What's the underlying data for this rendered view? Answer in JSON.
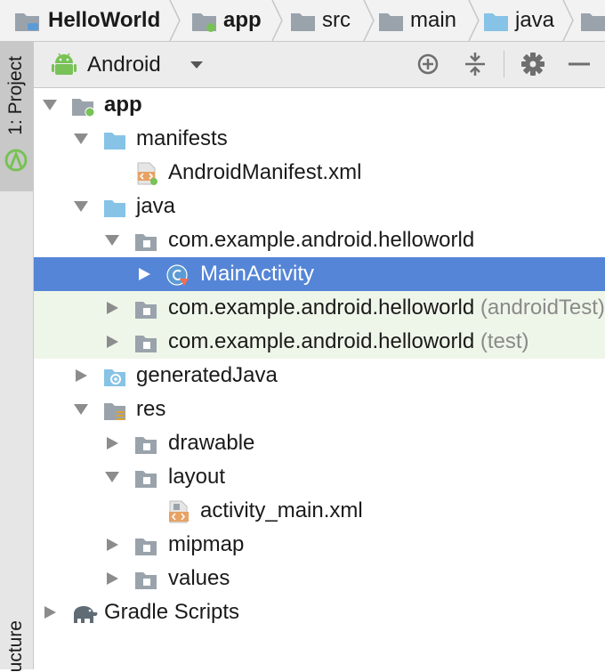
{
  "breadcrumb": {
    "items": [
      {
        "label": "HelloWorld",
        "bold": true
      },
      {
        "label": "app",
        "bold": true
      },
      {
        "label": "src",
        "bold": false
      },
      {
        "label": "main",
        "bold": false
      },
      {
        "label": "java",
        "bold": false
      }
    ]
  },
  "tool_windows": {
    "project_tab": "1: Project",
    "structure_tab": "ucture"
  },
  "panel": {
    "view_mode": "Android"
  },
  "tree": {
    "app": "app",
    "manifests": "manifests",
    "android_manifest": "AndroidManifest.xml",
    "java": "java",
    "pkg_main": "com.example.android.helloworld",
    "main_activity": "MainActivity",
    "pkg_android_test": "com.example.android.helloworld",
    "pkg_android_test_suffix": "(androidTest)",
    "pkg_test": "com.example.android.helloworld",
    "pkg_test_suffix": "(test)",
    "generated_java": "generatedJava",
    "res": "res",
    "drawable": "drawable",
    "layout": "layout",
    "activity_main": "activity_main.xml",
    "mipmap": "mipmap",
    "values": "values",
    "gradle_scripts": "Gradle Scripts"
  },
  "colors": {
    "selection": "#5585d6",
    "test_row": "#eef6e9",
    "folder_blue": "#87c3e6",
    "folder_grey": "#9aa3ab",
    "android_green": "#78c257"
  }
}
